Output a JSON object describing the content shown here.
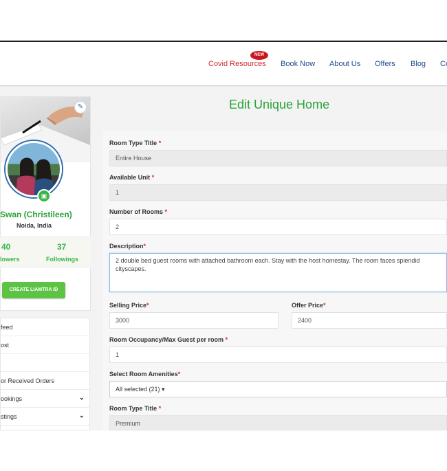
{
  "nav": {
    "items": [
      {
        "label": "Covid Resources",
        "badge": "NEW"
      },
      {
        "label": "Book Now"
      },
      {
        "label": "About Us"
      },
      {
        "label": "Offers"
      },
      {
        "label": "Blog"
      },
      {
        "label": "Co"
      }
    ]
  },
  "profile": {
    "name": "Swan (Christileen)",
    "location": "Noida, India",
    "followers_count": "40",
    "followers_label": "lowers",
    "followings_count": "37",
    "followings_label": "Followings",
    "create_button": "CREATE LIAMTRA ID"
  },
  "menu": {
    "items": [
      {
        "label": "feed",
        "chevron": false
      },
      {
        "label": "ost",
        "chevron": false
      },
      {
        "label": "",
        "chevron": false
      },
      {
        "label": "or Received Orders",
        "chevron": false
      },
      {
        "label": "ookings",
        "chevron": true
      },
      {
        "label": "stings",
        "chevron": true
      }
    ]
  },
  "form": {
    "title": "Edit Unique Home",
    "room_type_title_label": "Room Type Title",
    "room_type_title_value": "Entire House",
    "available_unit_label": "Available Unit",
    "available_unit_value": "1",
    "number_of_rooms_label": "Number of Rooms",
    "number_of_rooms_value": "2",
    "description_label": "Description",
    "description_value": "2 double bed guest rooms with attached bathroom each. Stay with the host homestay. The room faces splendid cityscapes.",
    "selling_price_label": "Selling Price",
    "selling_price_value": "3000",
    "offer_price_label": "Offer Price",
    "offer_price_value": "2400",
    "occupancy_label": "Room Occupancy/Max Guest per room",
    "occupancy_value": "1",
    "amenities_label": "Select Room Amenities",
    "amenities_value": "All selected (21)",
    "room_type_title2_label": "Room Type Title",
    "room_type_title2_value": "Premium",
    "required_mark": "*"
  },
  "colors": {
    "accent_green": "#2aa23a",
    "nav_blue": "#1f4a8a",
    "covid_red": "#d22a2a",
    "button_green": "#5cc345"
  },
  "icons": [
    "edit-icon",
    "camera-icon",
    "chevron-down-icon",
    "caret-down-icon"
  ]
}
